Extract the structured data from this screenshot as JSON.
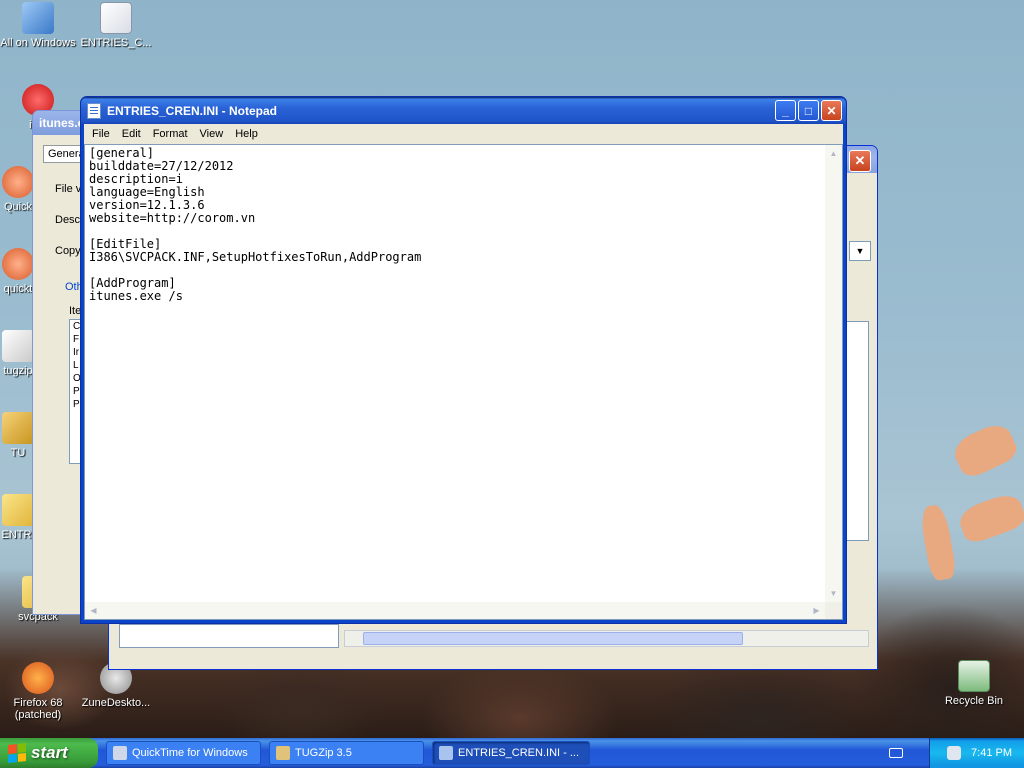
{
  "desktop": {
    "icons": [
      {
        "label": "All on Windows"
      },
      {
        "label": "ENTRIES_C..."
      },
      {
        "label": "itun"
      },
      {
        "label": "Quick"
      },
      {
        "label": "quickt"
      },
      {
        "label": "tugzip"
      },
      {
        "label": "TU"
      },
      {
        "label": "ENTRI"
      },
      {
        "label": "svcpack"
      },
      {
        "label": "Firefox 68 (patched)"
      },
      {
        "label": "ZuneDeskto..."
      },
      {
        "label": "Recycle Bin"
      }
    ]
  },
  "background_window": {
    "title": "itunes.e",
    "tab": "Genera",
    "labels": [
      "File v",
      "Desc",
      "Copy",
      "Oth",
      "Ite"
    ],
    "list_letters": [
      "C",
      "F",
      "Ir",
      "L",
      "O",
      "P",
      "P"
    ]
  },
  "notepad": {
    "title": "ENTRIES_CREN.INI - Notepad",
    "menu": [
      "File",
      "Edit",
      "Format",
      "View",
      "Help"
    ],
    "content": "[general]\nbuilddate=27/12/2012\ndescription=i\nlanguage=English\nversion=12.1.3.6\nwebsite=http://corom.vn\n\n[EditFile]\nI386\\SVCPACK.INF,SetupHotfixesToRun,AddProgram\n\n[AddProgram]\nitunes.exe /s"
  },
  "taskbar": {
    "start_label": "start",
    "tasks": [
      {
        "label": "QuickTime for Windows",
        "active": false
      },
      {
        "label": "TUGZip 3.5",
        "active": false
      },
      {
        "label": "ENTRIES_CREN.INI - ...",
        "active": true
      }
    ],
    "clock": "7:41 PM"
  }
}
